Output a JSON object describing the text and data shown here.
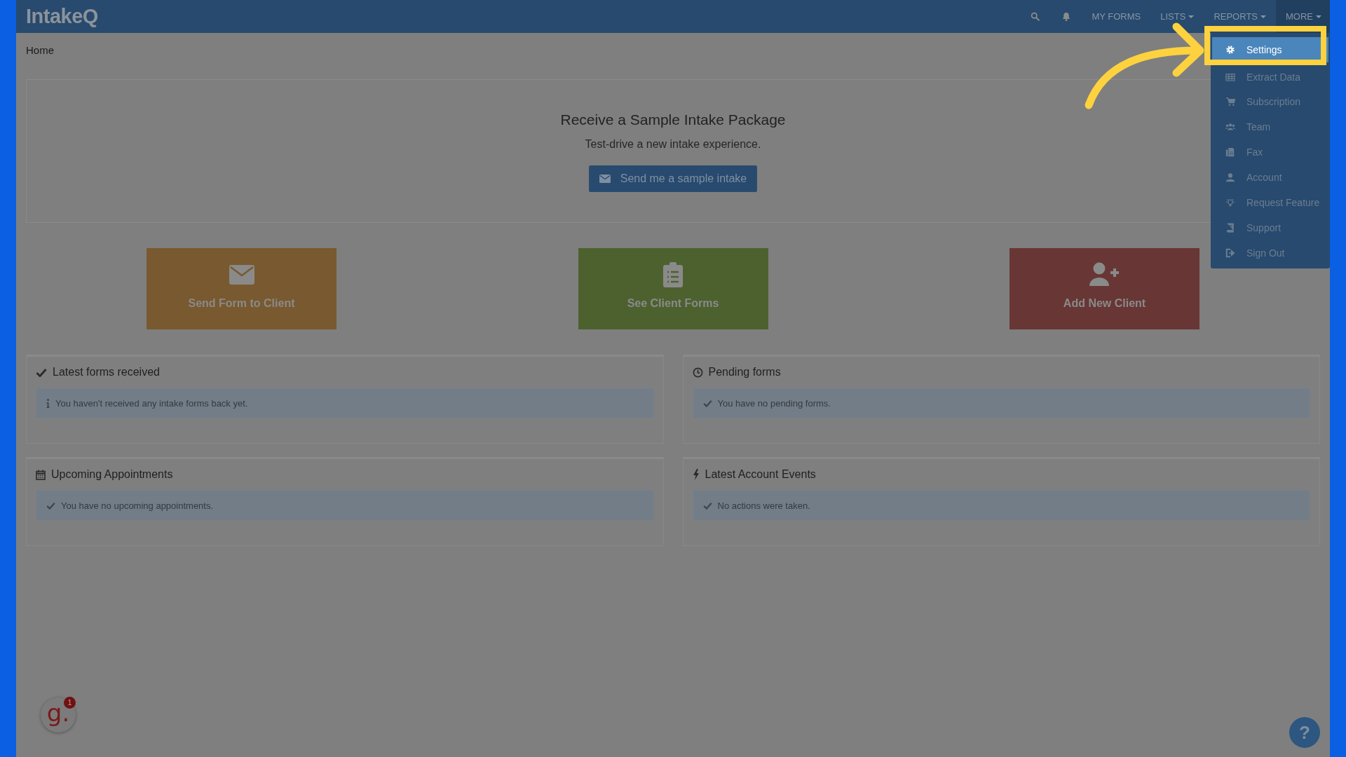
{
  "logo": "IntakeQ",
  "nav": [
    {
      "label": "MY FORMS",
      "has_menu": false,
      "open": false
    },
    {
      "label": "LISTS",
      "has_menu": true,
      "open": false
    },
    {
      "label": "REPORTS",
      "has_menu": true,
      "open": false
    },
    {
      "label": "MORE",
      "has_menu": true,
      "open": true
    }
  ],
  "menu": [
    {
      "label": "Settings",
      "selected": true
    },
    {
      "label": "Extract Data",
      "selected": false
    },
    {
      "label": "Subscription",
      "selected": false
    },
    {
      "label": "Team",
      "selected": false
    },
    {
      "label": "Fax",
      "selected": false
    },
    {
      "label": "Account",
      "selected": false
    },
    {
      "label": "Request Feature",
      "selected": false
    },
    {
      "label": "Support",
      "selected": false
    },
    {
      "label": "Sign Out",
      "selected": false
    }
  ],
  "breadcrumb": "Home",
  "promo": {
    "title": "Receive a Sample Intake Package",
    "subtitle": "Test-drive a new intake experience.",
    "button": "Send me a sample intake"
  },
  "tiles": [
    {
      "label": "Send Form to Client",
      "color": "#79592f"
    },
    {
      "label": "See Client Forms",
      "color": "#4d612f"
    },
    {
      "label": "Add New Client",
      "color": "#683634"
    }
  ],
  "panels": [
    {
      "title": "Latest forms received",
      "message": "You haven't received any intake forms back yet."
    },
    {
      "title": "Pending forms",
      "message": "You have no pending forms."
    },
    {
      "title": "Upcoming Appointments",
      "message": "You have no upcoming appointments."
    },
    {
      "title": "Latest Account Events",
      "message": "No actions were taken."
    }
  ],
  "chat_widget": {
    "letter": "g.",
    "count": "1"
  },
  "help_button": "?"
}
